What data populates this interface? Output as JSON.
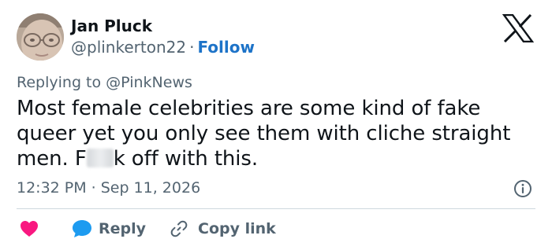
{
  "author": {
    "display_name": "Jan Pluck",
    "handle": "@plinkerton22",
    "separator": "·",
    "follow_label": "Follow"
  },
  "reply_context": {
    "prefix": "Replying to",
    "mention": "@PinkNews"
  },
  "tweet": {
    "lines": [
      "Most female celebrities are some kind of fake",
      "queer yet you only see them with cliche straight"
    ],
    "line3_before": "men. F",
    "line3_after": "k off with this."
  },
  "meta": {
    "time": "12:32 PM",
    "separator": "·",
    "date": "Sep 11, 2026"
  },
  "actions": {
    "reply_label": "Reply",
    "copy_link_label": "Copy link"
  },
  "icons": {
    "brand": "x-logo-icon",
    "info": "info-icon",
    "like": "heart-icon",
    "reply": "speech-bubble-icon",
    "copy": "link-icon"
  },
  "colors": {
    "text": "#0f1419",
    "secondary": "#536471",
    "follow": "#1d73c8",
    "heart": "#f91880",
    "reply_bubble": "#1d9bf0",
    "divider": "#cfd9de"
  }
}
